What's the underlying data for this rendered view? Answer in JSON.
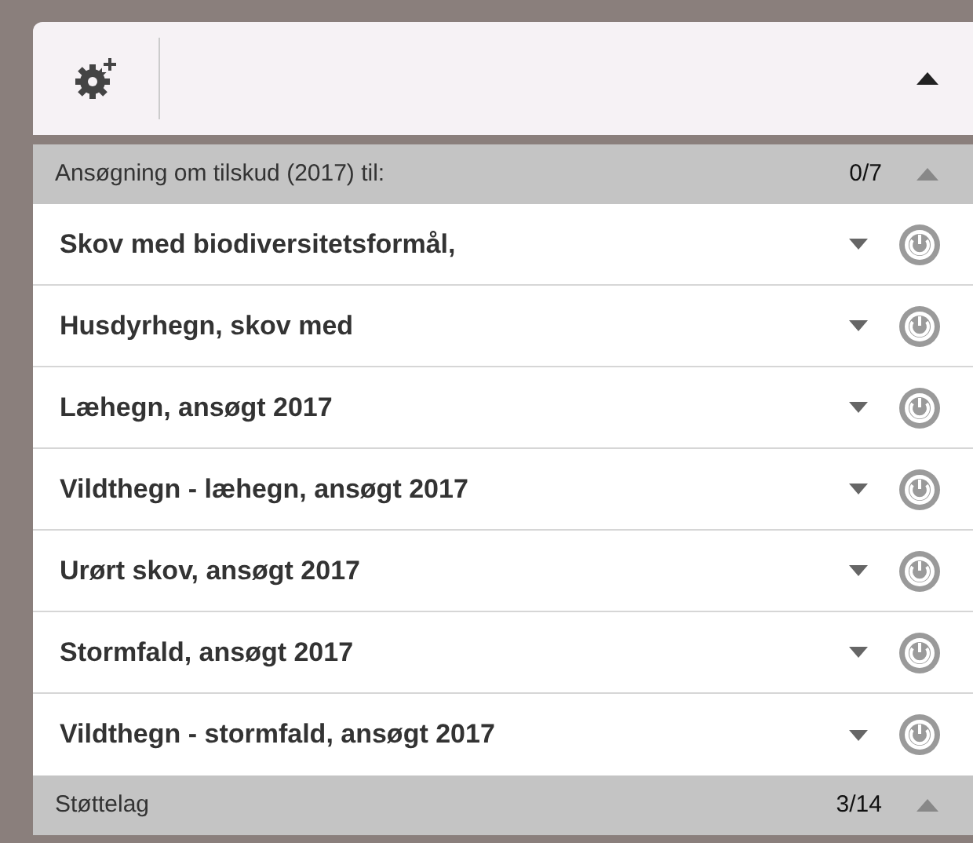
{
  "sections": [
    {
      "title": "Ansøgning om tilskud (2017) til:",
      "count": "0/7",
      "expanded": true,
      "items": [
        {
          "label": "Skov med biodiversitetsformål,",
          "on": false
        },
        {
          "label": "Husdyrhegn, skov med",
          "on": false
        },
        {
          "label": "Læhegn, ansøgt 2017",
          "on": false
        },
        {
          "label": "Vildthegn - læhegn, ansøgt 2017",
          "on": false
        },
        {
          "label": "Urørt skov, ansøgt 2017",
          "on": false
        },
        {
          "label": "Stormfald, ansøgt 2017",
          "on": false
        },
        {
          "label": "Vildthegn - stormfald, ansøgt 2017",
          "on": false
        }
      ]
    },
    {
      "title": "Støttelag",
      "count": "3/14",
      "expanded": true
    }
  ]
}
